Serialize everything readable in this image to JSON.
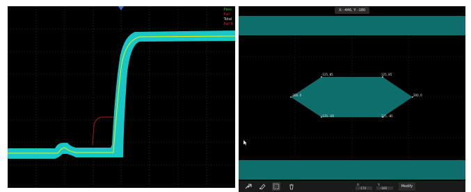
{
  "left_scope": {
    "legend": {
      "pass": "Pass",
      "fail": "Fail",
      "total": "Total",
      "fail_rate": "Fail R"
    },
    "colors": {
      "mask": "#18c8c8",
      "trace": "#f2f200",
      "ref_trace": "#8b1a1a",
      "grid": "#4a4a4a",
      "trigger_marker": "#3a6fd8"
    }
  },
  "mask_editor": {
    "coord_readout": "X: -446, Y: -180",
    "vertices": {
      "top_left": "-125, 85",
      "top_right": "125, 85",
      "left": "-200, 0",
      "right": "200, 0",
      "bottom_left": "-125, -85",
      "bottom_right": "125, -85"
    },
    "colors": {
      "mask_fill": "#0e6e6c",
      "background": "#000000"
    },
    "toolbar": {
      "tools": [
        "share-icon",
        "pen-icon",
        "select-box-icon",
        "trash-icon"
      ],
      "x_label": "X:",
      "x_value": "-174",
      "y_label": "Y:",
      "y_value": "-160",
      "modify_label": "Modify"
    }
  }
}
